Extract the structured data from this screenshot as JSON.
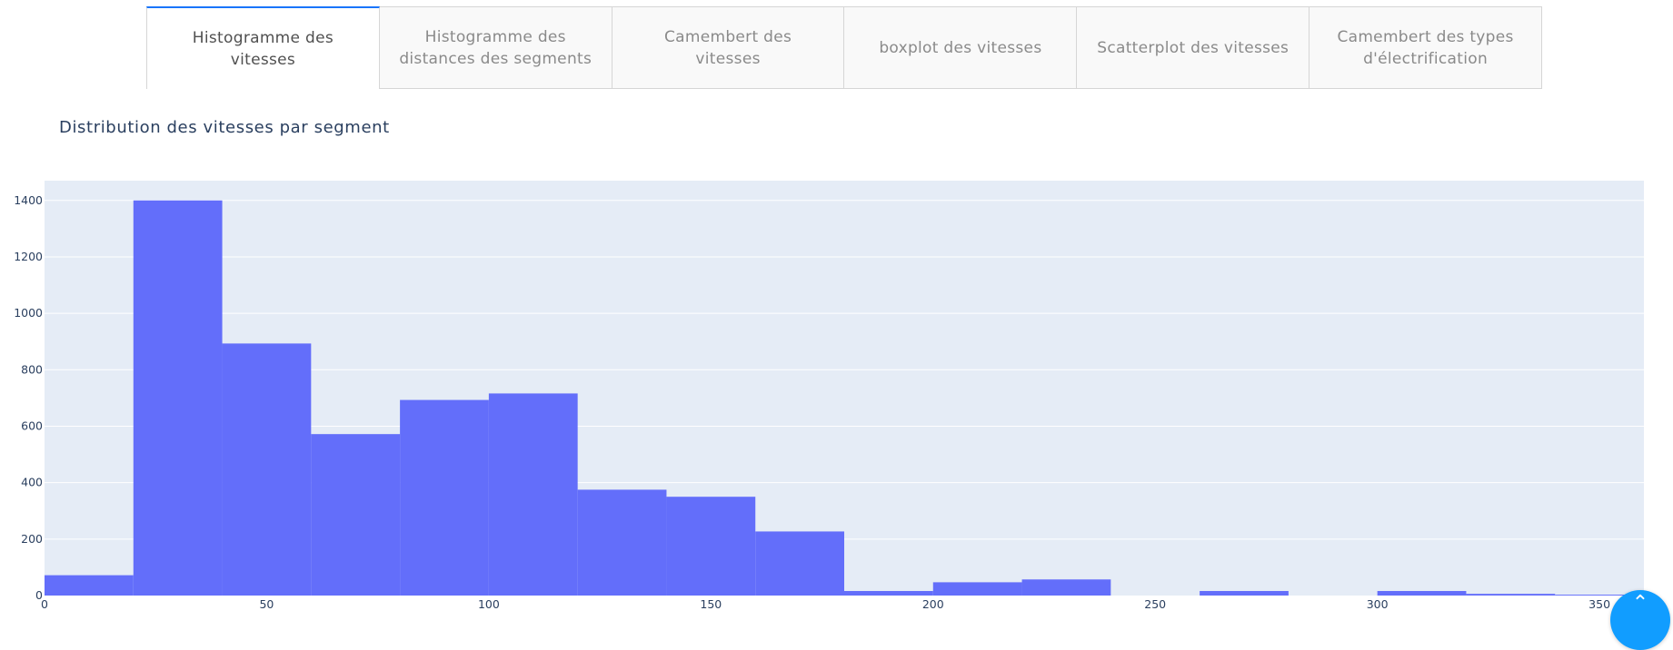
{
  "tabs": [
    {
      "label": "Histogramme des vitesses",
      "active": true
    },
    {
      "label": "Histogramme des distances des segments",
      "active": false
    },
    {
      "label": "Camembert des vitesses",
      "active": false
    },
    {
      "label": "boxplot des vitesses",
      "active": false
    },
    {
      "label": "Scatterplot des vitesses",
      "active": false
    },
    {
      "label": "Camembert des types d'électrification",
      "active": false
    }
  ],
  "chart_data": {
    "type": "bar",
    "title": "Distribution des vitesses par segment",
    "xlabel": "",
    "ylabel": "",
    "bin_edges": [
      0,
      20,
      40,
      60,
      80,
      100,
      120,
      140,
      160,
      180,
      200,
      220,
      240,
      260,
      280,
      300,
      320,
      340,
      360
    ],
    "values": [
      72,
      1400,
      893,
      572,
      693,
      716,
      375,
      350,
      227,
      16,
      47,
      57,
      0,
      16,
      0,
      16,
      6,
      3
    ],
    "xlim": [
      0,
      360
    ],
    "ylim": [
      0,
      1470
    ],
    "xticks": [
      0,
      50,
      100,
      150,
      200,
      250,
      300,
      350
    ],
    "yticks": [
      0,
      200,
      400,
      600,
      800,
      1000,
      1200,
      1400
    ],
    "grid": true,
    "bar_color": "#636efa",
    "plot_bg_color": "#e5ecf6"
  },
  "fab": {
    "icon": "chevron-up-icon",
    "color": "#119dff"
  }
}
